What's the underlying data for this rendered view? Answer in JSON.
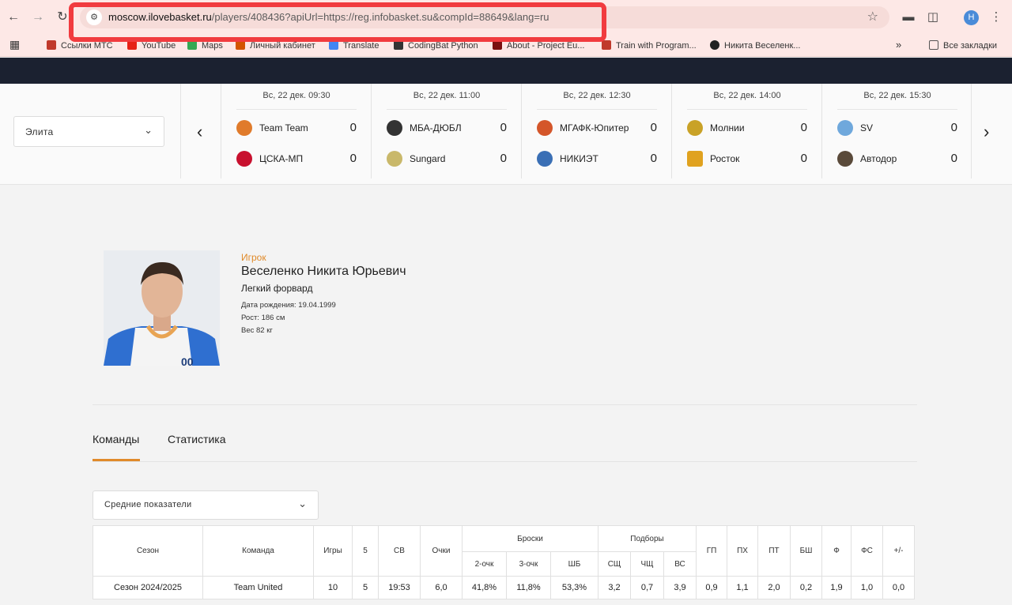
{
  "browser": {
    "url_host": "moscow.ilovebasket.ru",
    "url_path": "/players/408436?apiUrl=https://reg.infobasket.su&compId=88649&lang=ru",
    "profile_initial": "H"
  },
  "bookmarks": {
    "items": [
      {
        "label": "Ссылки МТС",
        "color": "#c0392b"
      },
      {
        "label": "YouTube",
        "color": "#e62117"
      },
      {
        "label": "Maps",
        "color": "#34a853"
      },
      {
        "label": "Личный кабинет",
        "color": "#d35400"
      },
      {
        "label": "Translate",
        "color": "#4285f4"
      },
      {
        "label": "CodingBat Python",
        "color": "#333333"
      },
      {
        "label": "About - Project Eu...",
        "color": "#7a1010"
      },
      {
        "label": "Train with Program...",
        "color": "#c0392b"
      },
      {
        "label": "Никита Веселенк...",
        "color": "#222222"
      }
    ],
    "all_bookmarks": "Все закладки"
  },
  "ticker": {
    "league": "Элита",
    "matches": [
      {
        "date": "Вс, 22 дек. 09:30",
        "home": {
          "name": "Team Team",
          "score": "0",
          "color": "#e07b2b"
        },
        "away": {
          "name": "ЦСКА-МП",
          "score": "0",
          "color": "#c8102e"
        }
      },
      {
        "date": "Вс, 22 дек. 11:00",
        "home": {
          "name": "МБА-ДЮБЛ",
          "score": "0",
          "color": "#333333"
        },
        "away": {
          "name": "Sungard",
          "score": "0",
          "color": "#c9b86a"
        }
      },
      {
        "date": "Вс, 22 дек. 12:30",
        "home": {
          "name": "МГАФК-Юпитер",
          "score": "0",
          "color": "#d4562a"
        },
        "away": {
          "name": "НИКИЭТ",
          "score": "0",
          "color": "#3a6fb5"
        }
      },
      {
        "date": "Вс, 22 дек. 14:00",
        "home": {
          "name": "Молнии",
          "score": "0",
          "color": "#c9a227"
        },
        "away": {
          "name": "Росток",
          "score": "0",
          "color": "#e0a21f"
        }
      },
      {
        "date": "Вс, 22 дек. 15:30",
        "home": {
          "name": "SV",
          "score": "0",
          "color": "#6fa8dc"
        },
        "away": {
          "name": "Автодор",
          "score": "0",
          "color": "#5a4a3a"
        }
      }
    ]
  },
  "player": {
    "role": "Игрок",
    "name": "Веселенко Никита Юрьевич",
    "position": "Легкий форвард",
    "birth": "Дата рождения: 19.04.1999",
    "height": "Рост: 186 см",
    "weight": "Вес 82 кг",
    "jersey": "00"
  },
  "tabs": [
    {
      "label": "Команды",
      "active": true
    },
    {
      "label": "Статистика",
      "active": false
    }
  ],
  "stats": {
    "select": "Средние показатели",
    "headers": {
      "season": "Сезон",
      "team": "Команда",
      "games": "Игры",
      "starts": "5",
      "time": "СВ",
      "points": "Очки",
      "shots": "Броски",
      "two": "2-очк",
      "three": "3-очк",
      "ft": "ШБ",
      "rebounds": "Подборы",
      "def": "СЩ",
      "off": "ЧЩ",
      "total": "ВС",
      "ast": "ГП",
      "stl": "ПХ",
      "tov": "ПТ",
      "blk": "БШ",
      "fouls": "Ф",
      "fd": "ФС",
      "pm": "+/-"
    },
    "rows": [
      {
        "season": "Сезон 2024/2025",
        "team": "Team United",
        "games": "10",
        "starts": "5",
        "time": "19:53",
        "points": "6,0",
        "two": "41,8%",
        "three": "11,8%",
        "ft": "53,3%",
        "def": "3,2",
        "off": "0,7",
        "total": "3,9",
        "ast": "0,9",
        "stl": "1,1",
        "tov": "2,0",
        "blk": "0,2",
        "fouls": "1,9",
        "fd": "1,0",
        "pm": "0,0"
      }
    ]
  }
}
